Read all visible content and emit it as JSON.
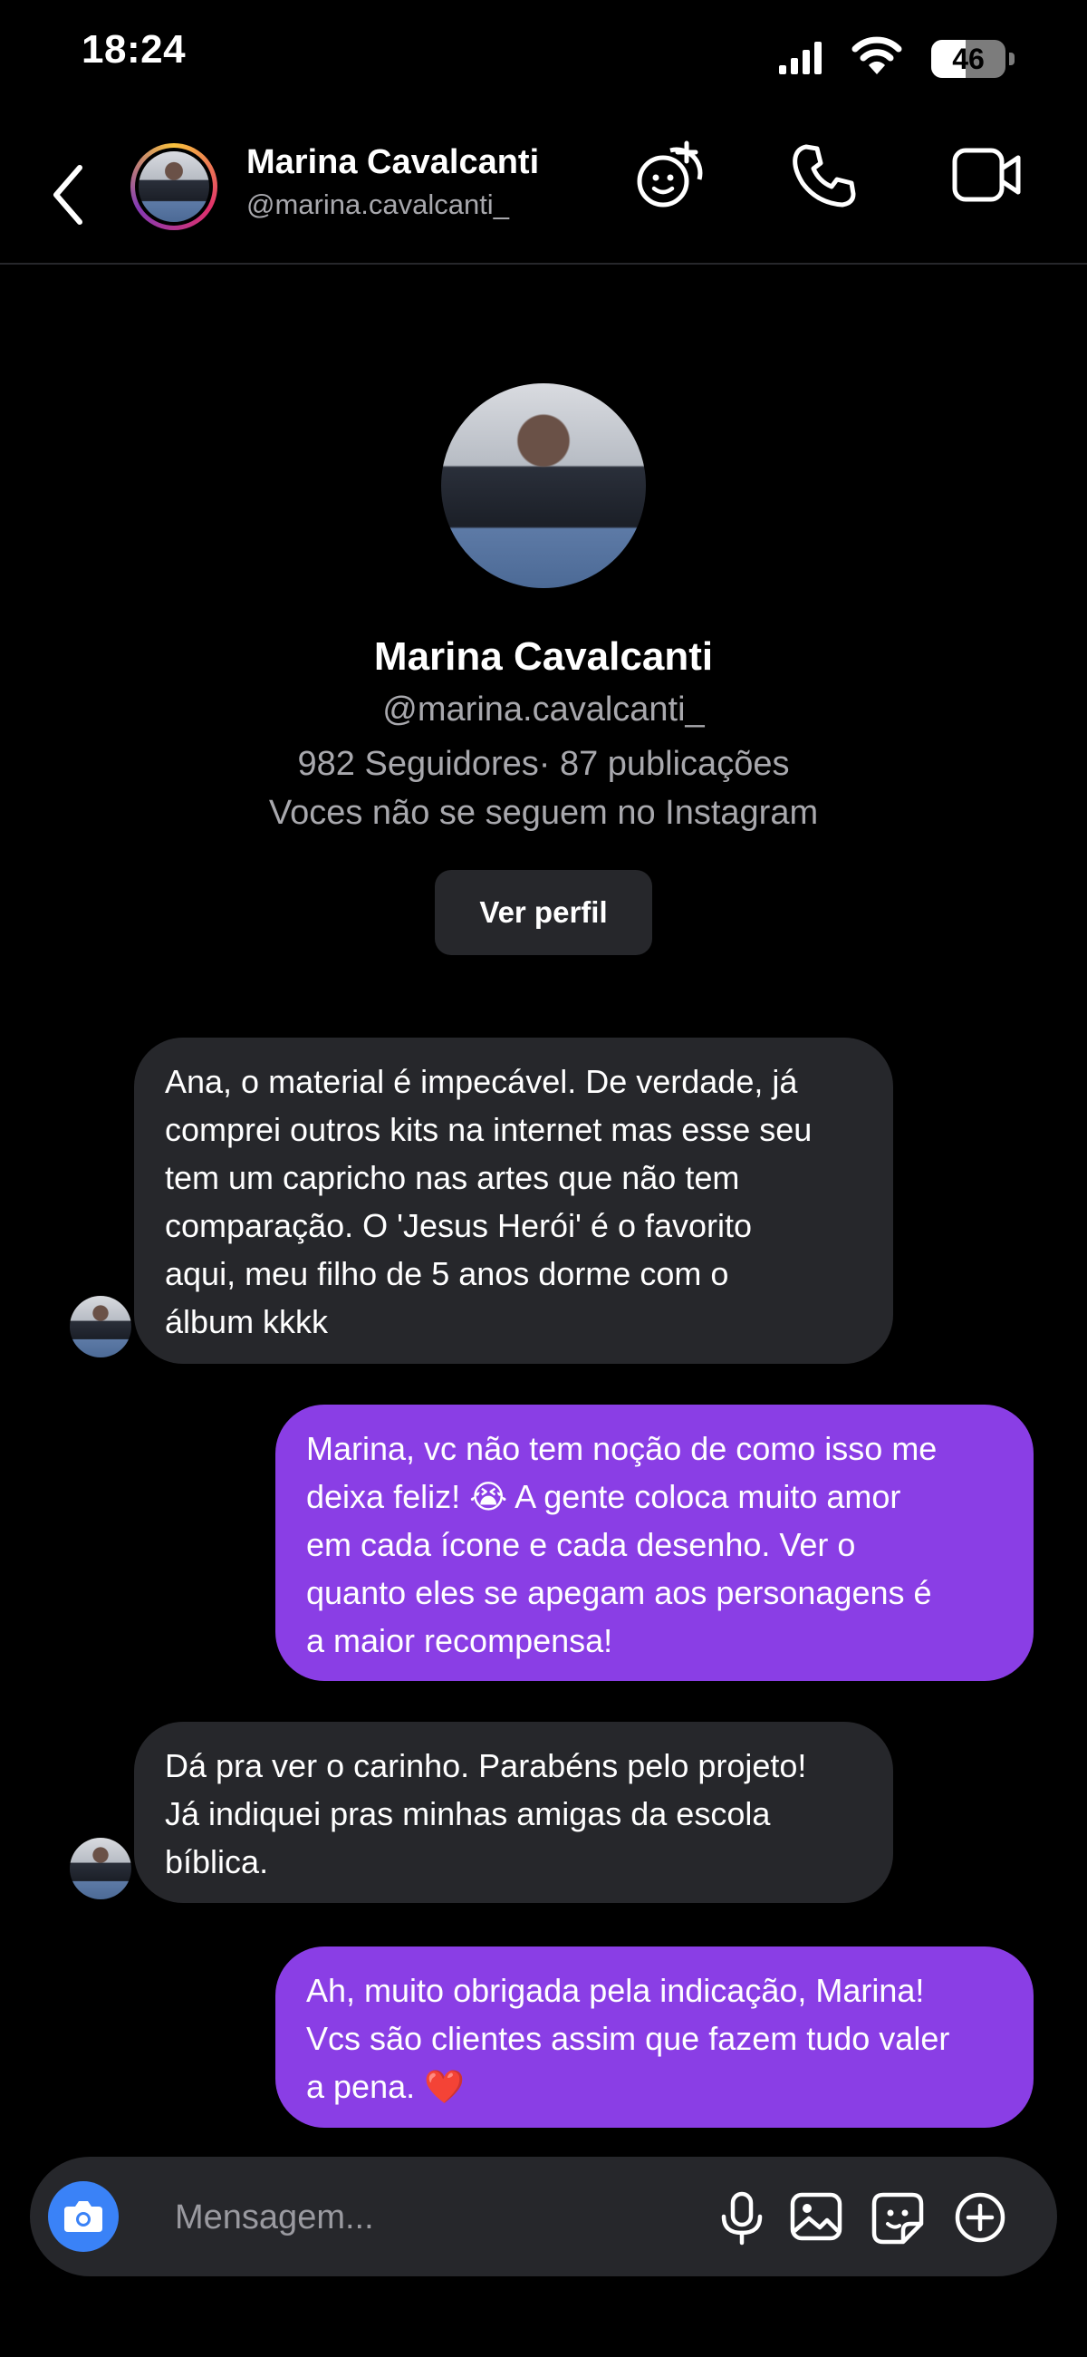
{
  "status_bar": {
    "time": "18:24",
    "battery_level": "46",
    "battery_fraction": 0.46
  },
  "header": {
    "name": "Marina Cavalcanti",
    "handle": "@marina.cavalcanti_",
    "icons": [
      "add-effect-icon",
      "phone-icon",
      "video-camera-icon"
    ]
  },
  "profile": {
    "name": "Marina Cavalcanti",
    "handle": "@marina.cavalcanti_",
    "stats": "982 Seguidores· 87 publicações",
    "follow_status": "Voces não se seguem no Instagram",
    "view_profile_label": "Ver perfil"
  },
  "messages": [
    {
      "direction": "incoming",
      "lines": [
        "Ana, o material é impecável. De verdade, já",
        "comprei outros kits na internet mas esse seu",
        "tem um capricho nas artes que não tem",
        "comparação. O 'Jesus Herói' é o favorito",
        "aqui, meu filho de 5 anos dorme com o",
        "álbum kkkk"
      ]
    },
    {
      "direction": "outgoing",
      "lines": [
        "Marina, vc não tem noção de como isso me",
        "deixa feliz! 😭 A gente coloca muito amor",
        "em cada ícone e cada desenho. Ver o",
        "quanto eles se apegam aos personagens é",
        "a maior recompensa!"
      ]
    },
    {
      "direction": "incoming",
      "lines": [
        "Dá pra ver o carinho. Parabéns pelo projeto!",
        "Já indiquei pras minhas amigas da escola",
        "bíblica."
      ]
    },
    {
      "direction": "outgoing",
      "lines": [
        "Ah, muito obrigada pela indicação, Marina!",
        "Vcs são clientes assim que fazem tudo valer",
        "a pena. ❤️"
      ]
    }
  ],
  "composer": {
    "placeholder": "Mensagem...",
    "icons": [
      "camera-icon",
      "microphone-icon",
      "gallery-icon",
      "sticker-icon",
      "plus-icon"
    ]
  },
  "colors": {
    "outgoing_bubble": "#8a3ee5",
    "incoming_bubble": "#26272b",
    "camera_button": "#3a82f7"
  }
}
